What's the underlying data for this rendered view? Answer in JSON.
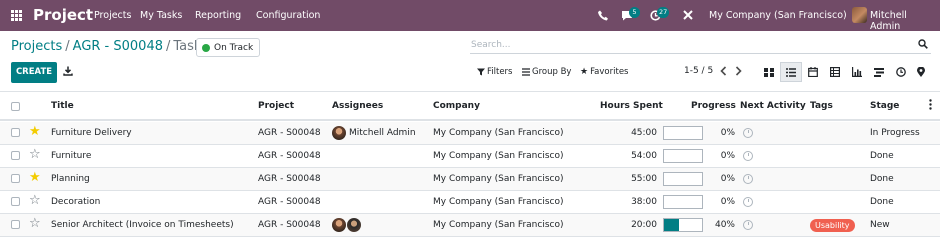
{
  "navbar": {
    "app_title": "Project",
    "menu": [
      "Projects",
      "My Tasks",
      "Reporting",
      "Configuration"
    ],
    "messages_count": "5",
    "activities_count": "27",
    "company": "My Company (San Francisco)",
    "user": "Mitchell Admin",
    "bg_color": "#714b67"
  },
  "breadcrumb": {
    "root": "Projects",
    "project": "AGR - S00048",
    "current": "Tasks"
  },
  "status": {
    "label": "On Track",
    "color": "#28a745"
  },
  "search": {
    "placeholder": "Search..."
  },
  "toolbar": {
    "create_label": "CREATE",
    "filters_label": "Filters",
    "group_by_label": "Group By",
    "favorites_label": "Favorites",
    "pager": "1-5 / 5"
  },
  "views": [
    "kanban-icon",
    "list-icon",
    "calendar-icon",
    "pivot-icon",
    "graph-icon",
    "gantt-icon",
    "activity-icon",
    "map-icon"
  ],
  "table": {
    "columns": {
      "title": "Title",
      "project": "Project",
      "assignees": "Assignees",
      "company": "Company",
      "hours": "Hours Spent",
      "progress": "Progress",
      "next_activity": "Next Activity",
      "tags": "Tags",
      "stage": "Stage"
    },
    "rows": [
      {
        "starred": true,
        "title": "Furniture Delivery",
        "project": "AGR - S00048",
        "assignee": "Mitchell Admin",
        "avatars": 1,
        "company": "My Company (San Francisco)",
        "hours": "45:00",
        "progress": 0,
        "progress_label": "0%",
        "tag": "",
        "stage": "In Progress"
      },
      {
        "starred": false,
        "title": "Furniture",
        "project": "AGR - S00048",
        "assignee": "",
        "avatars": 0,
        "company": "My Company (San Francisco)",
        "hours": "54:00",
        "progress": 0,
        "progress_label": "0%",
        "tag": "",
        "stage": "Done"
      },
      {
        "starred": true,
        "title": "Planning",
        "project": "AGR - S00048",
        "assignee": "",
        "avatars": 0,
        "company": "My Company (San Francisco)",
        "hours": "55:00",
        "progress": 0,
        "progress_label": "0%",
        "tag": "",
        "stage": "Done"
      },
      {
        "starred": false,
        "title": "Decoration",
        "project": "AGR - S00048",
        "assignee": "",
        "avatars": 0,
        "company": "My Company (San Francisco)",
        "hours": "38:00",
        "progress": 0,
        "progress_label": "0%",
        "tag": "",
        "stage": "Done"
      },
      {
        "starred": false,
        "title": "Senior Architect (Invoice on Timesheets)",
        "project": "AGR - S00048",
        "assignee": "",
        "avatars": 2,
        "company": "My Company (San Francisco)",
        "hours": "20:00",
        "progress": 0.4,
        "progress_label": "40%",
        "tag": "Usability",
        "stage": "New"
      }
    ]
  }
}
